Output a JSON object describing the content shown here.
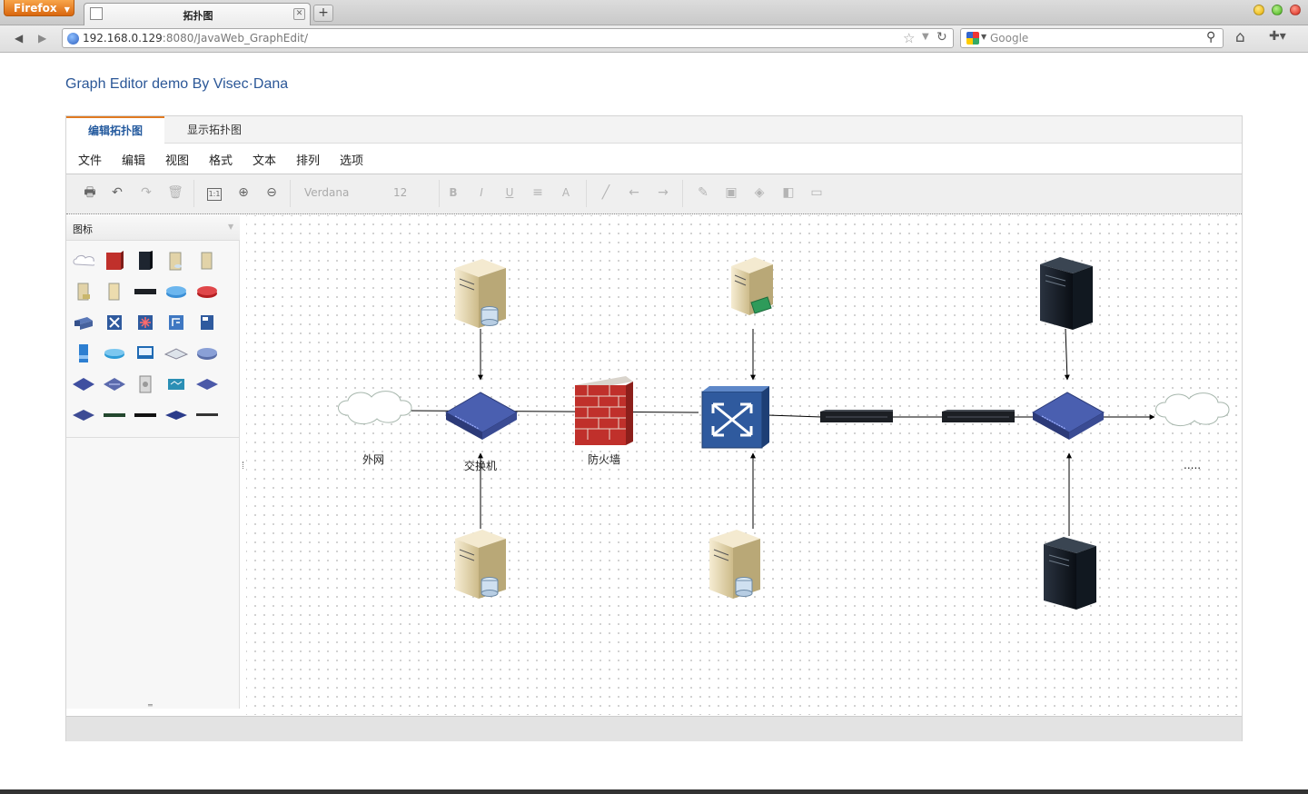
{
  "browser": {
    "app_button": "Firefox",
    "tab_title": "拓扑图",
    "new_tab": "+",
    "url_host": "192.168.0.129",
    "url_rest": ":8080/JavaWeb_GraphEdit/",
    "search_placeholder": "Google"
  },
  "page": {
    "title": "Graph Editor demo By Visec·Dana"
  },
  "editor": {
    "tabs": [
      {
        "label": "编辑拓扑图",
        "active": true
      },
      {
        "label": "显示拓扑图",
        "active": false
      }
    ],
    "menu": [
      "文件",
      "编辑",
      "视图",
      "格式",
      "文本",
      "排列",
      "选项"
    ],
    "toolbar": {
      "font_family": "Verdana",
      "font_size": "12",
      "bold": "B",
      "italic": "I",
      "underline": "U",
      "font_color": "A"
    },
    "sidebar": {
      "title": "图标"
    },
    "diagram": {
      "labels": {
        "internet": "外网",
        "switch": "交换机",
        "firewall": "防火墙",
        "more": "....."
      }
    }
  },
  "colors": {
    "accent": "#2b5797",
    "tab_active_border": "#e07a22",
    "node_switch": "#3e4f9a",
    "edge": "#000000"
  }
}
